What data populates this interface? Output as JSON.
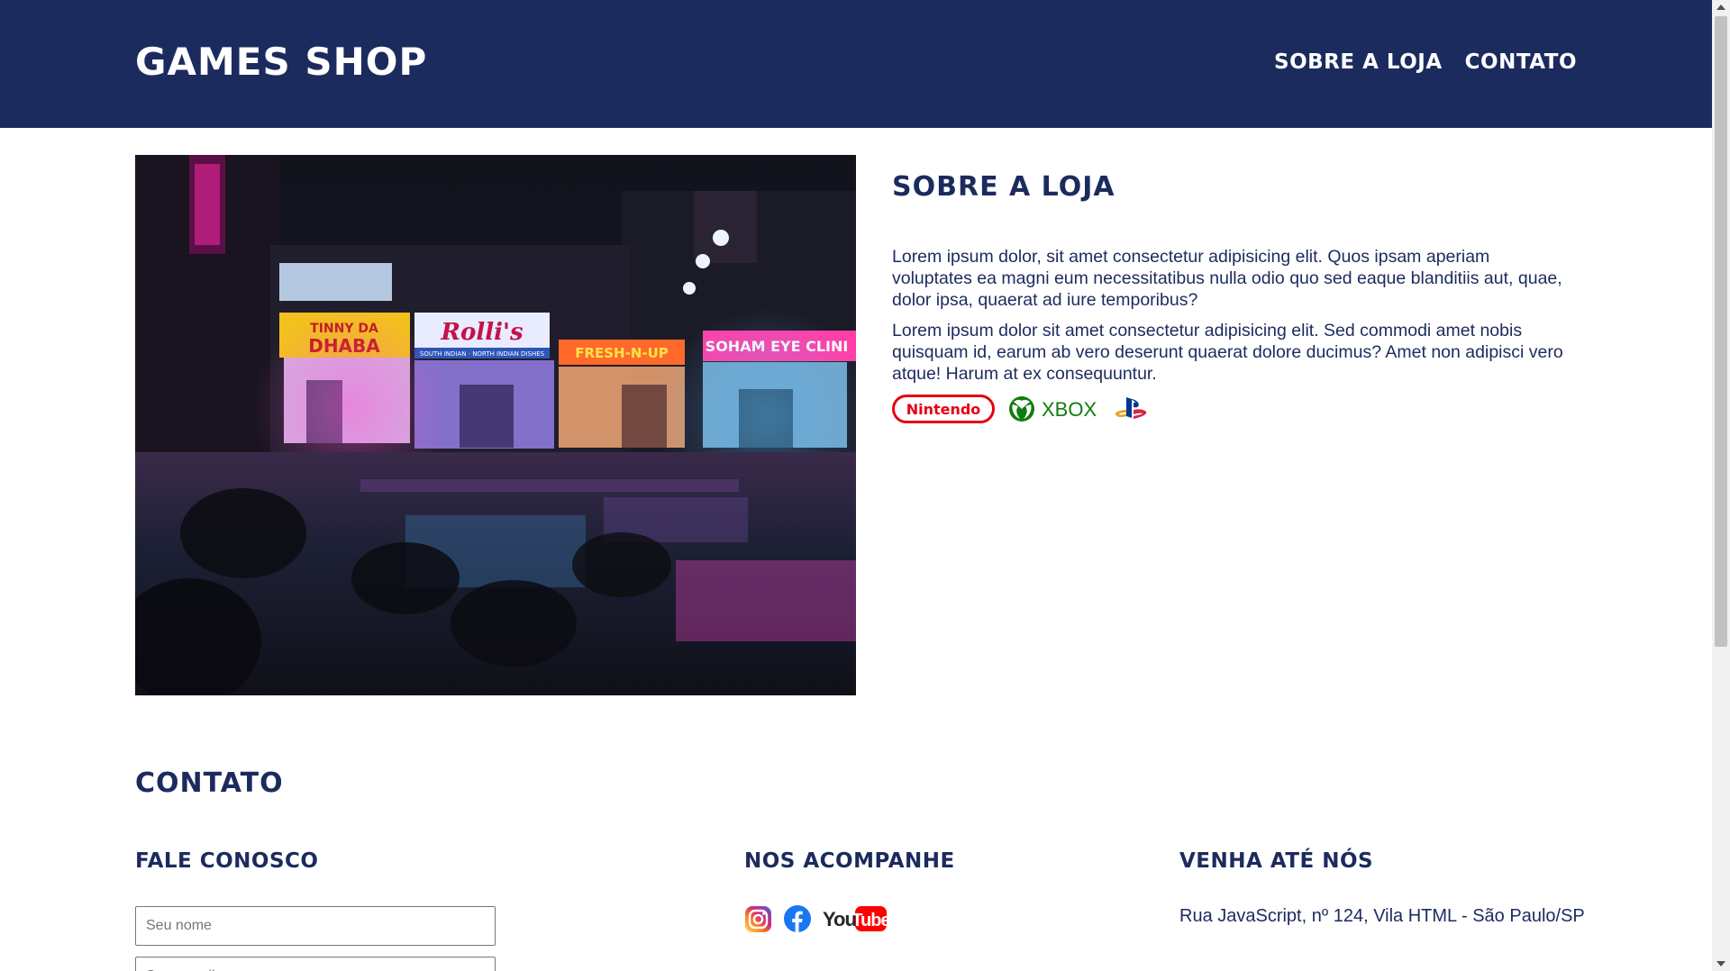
{
  "header": {
    "brand": "Games Shop",
    "nav": [
      {
        "label": "Sobre a loja"
      },
      {
        "label": "Contato"
      }
    ]
  },
  "about": {
    "title": "Sobre a loja",
    "paragraphs": [
      "Lorem ipsum dolor, sit amet consectetur adipisicing elit. Quos ipsam aperiam voluptates ea magni eum necessitatibus nulla odio quo sed eaque blanditiis aut, quae, dolor ipsa, quaerat ad iure temporibus?",
      "Lorem ipsum dolor sit amet consectetur adipisicing elit. Sed commodi amet nobis quisquam id, earum ab vero deserunt quaerat dolore ducimus? Amet non adipisci vero atque! Harum at ex consequuntur."
    ],
    "brands": [
      {
        "name": "Nintendo",
        "icon": "nintendo-logo",
        "color": "#e60012"
      },
      {
        "name": "XBOX",
        "icon": "xbox-logo",
        "color": "#107c10"
      },
      {
        "name": "",
        "icon": "playstation-logo",
        "color": "#003791"
      }
    ],
    "photo_signs": [
      "TINNY DA",
      "DHABA",
      "Rolli's",
      "SOUTH INDIAN · NORTH INDIAN DISHES",
      "FRESH-N-UP",
      "SOHAM EYE CLINI"
    ]
  },
  "contact": {
    "title": "Contato",
    "columns": {
      "form": {
        "title": "Fale conosco",
        "name_placeholder": "Seu nome",
        "email_placeholder": "Seu e-mail"
      },
      "social": {
        "title": "Nos acompanhe",
        "icons": [
          "instagram-icon",
          "facebook-icon",
          "youtube-icon"
        ],
        "youtube_text_you": "You",
        "youtube_text_tube": "Tube"
      },
      "location": {
        "title": "Venha até nós",
        "address": "Rua JavaScript, nº 124, Vila HTML - São Paulo/SP"
      }
    }
  },
  "colors": {
    "primary": "#1c2b5e",
    "background": "#ffffff"
  }
}
